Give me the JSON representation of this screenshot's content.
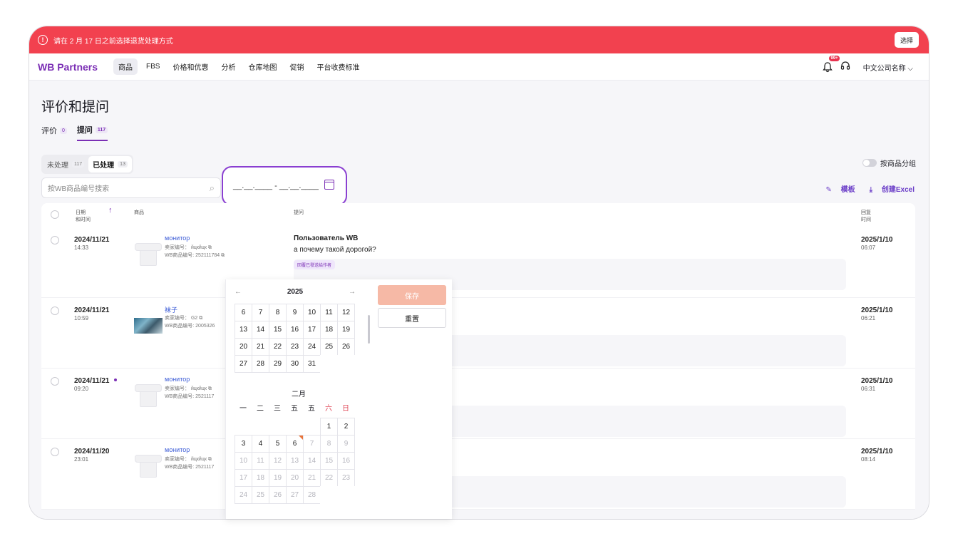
{
  "banner": {
    "message": "请在 2 月 17 日之前选择退货处理方式",
    "button": "选择"
  },
  "nav": {
    "logo": "WB Partners",
    "items": [
      "商品",
      "FBS",
      "价格和优惠",
      "分析",
      "仓库地图",
      "促销",
      "平台收费标准"
    ],
    "notif_badge": "99+",
    "company": "中文公司名称 ⌵"
  },
  "page": {
    "title": "评价和提问"
  },
  "tabs": [
    {
      "label": "评价",
      "count": "0"
    },
    {
      "label": "提问",
      "count": "117"
    }
  ],
  "segments": [
    {
      "label": "未处理",
      "count": "117"
    },
    {
      "label": "已处理",
      "count": "13"
    }
  ],
  "group_toggle": {
    "label": "按商品分组"
  },
  "search": {
    "placeholder": "按WB商品编号搜索"
  },
  "date_range": {
    "value": "__.__.____ - __.__.____"
  },
  "toolbar": {
    "template": "模板",
    "excel": "创建Excel"
  },
  "table_head": {
    "date_line1": "日期",
    "date_line2": "和时间",
    "sort_icon": "↑",
    "product": "商品",
    "question": "提问",
    "reply_line1": "回复",
    "reply_line2": "时间"
  },
  "rows": [
    {
      "date": "2024/11/21",
      "time": "14:33",
      "thumb": "tshirt-icon",
      "name": "монитор",
      "seller_code": "卖家编号： йцкйцк ⧉",
      "wb_code": "WB商品编号: 252111784 ⧉",
      "question_user": "Пользователь WB",
      "question": "а почему такой дорогой?",
      "tag": "回覆已發送給作者",
      "reply_date": "2025/1/10",
      "reply_time": "06:07"
    },
    {
      "date": "2024/11/21",
      "time": "10:59",
      "thumb": "photo",
      "name": "袜子",
      "seller_code": "卖家编号： G2 ⧉",
      "wb_code": "WB商品编号: 2005326",
      "question_user": "",
      "question": "",
      "tag": "",
      "reply_date": "2025/1/10",
      "reply_time": "06:21"
    },
    {
      "date": "2024/11/21",
      "time": "09:20",
      "thumb": "tshirt-icon",
      "name": "монитор",
      "seller_code": "卖家编号： йцкйцк ⧉",
      "wb_code": "WB商品编号: 2521117",
      "question_user": "",
      "question": "",
      "tag": "",
      "reply_date": "2025/1/10",
      "reply_time": "06:31"
    },
    {
      "date": "2024/11/20",
      "time": "23:01",
      "thumb": "tshirt-icon",
      "name": "монитор",
      "seller_code": "卖家编号： йцкйцк ⧉",
      "wb_code": "WB商品编号: 2521117",
      "question_user": "",
      "question": "",
      "tag": "",
      "reply_date": "2025/1/10",
      "reply_time": "08:14"
    }
  ],
  "calendar": {
    "year": "2025",
    "prev": "←",
    "next": "→",
    "jan_rows": [
      [
        "6",
        "7",
        "8",
        "9",
        "10",
        "11",
        "12"
      ],
      [
        "13",
        "14",
        "15",
        "16",
        "17",
        "18",
        "19"
      ],
      [
        "20",
        "21",
        "22",
        "23",
        "24",
        "25",
        "26"
      ],
      [
        "27",
        "28",
        "29",
        "30",
        "31",
        "",
        ""
      ]
    ],
    "feb_label": "二月",
    "weekdays": [
      "一",
      "二",
      "三",
      "五",
      "五",
      "六",
      "日"
    ],
    "feb_rows": [
      [
        "",
        "",
        "",
        "",
        "",
        "1",
        "2"
      ],
      [
        "3",
        "4",
        "5",
        "6",
        "7",
        "8",
        "9"
      ],
      [
        "10",
        "11",
        "12",
        "13",
        "14",
        "15",
        "16"
      ],
      [
        "17",
        "18",
        "19",
        "20",
        "21",
        "22",
        "23"
      ],
      [
        "24",
        "25",
        "26",
        "27",
        "28",
        "",
        ""
      ]
    ],
    "today_marker": "6",
    "save": "保存",
    "reset": "重置"
  }
}
